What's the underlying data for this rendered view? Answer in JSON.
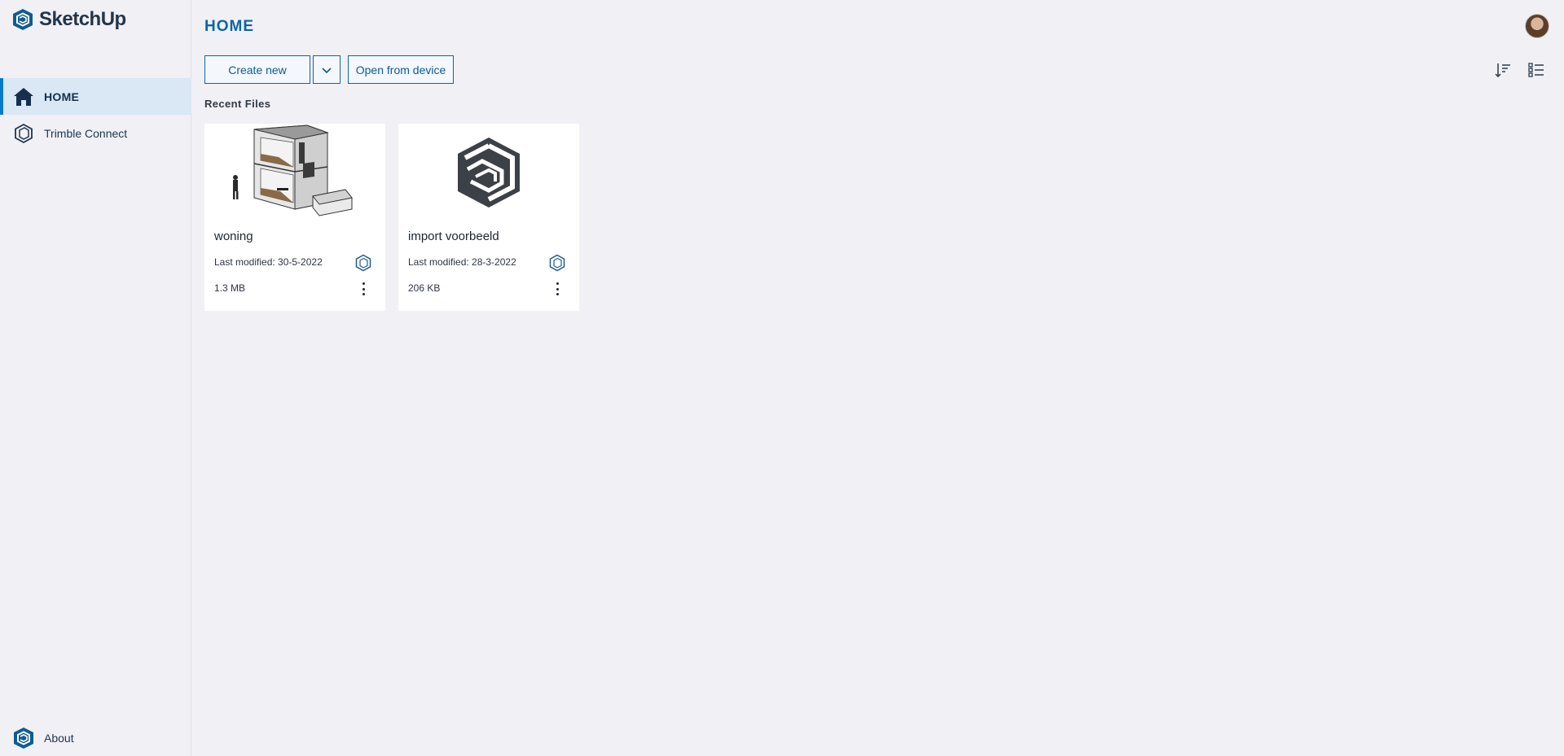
{
  "brand": {
    "name": "SketchUp",
    "icon": "sketchup-logo-icon"
  },
  "sidebar": {
    "items": [
      {
        "label": "HOME",
        "icon": "home-icon",
        "active": true
      },
      {
        "label": "Trimble Connect",
        "icon": "trimble-connect-icon",
        "active": false
      }
    ],
    "about_label": "About"
  },
  "header": {
    "title": "HOME"
  },
  "toolbar": {
    "create_label": "Create new",
    "dropdown_icon": "chevron-down-icon",
    "open_label": "Open from device",
    "sort_icon": "sort-icon",
    "view_icon": "list-view-icon"
  },
  "recent": {
    "title": "Recent Files",
    "files": [
      {
        "name": "woning",
        "modified": "Last modified: 30-5-2022",
        "size": "1.3 MB",
        "thumb": "house-model"
      },
      {
        "name": "import voorbeeld",
        "modified": "Last modified: 28-3-2022",
        "size": "206 KB",
        "thumb": "sketchup-logo"
      }
    ]
  },
  "colors": {
    "accent": "#0a66a9",
    "active_bg": "#dae7f5",
    "background": "#f1f0f5"
  }
}
